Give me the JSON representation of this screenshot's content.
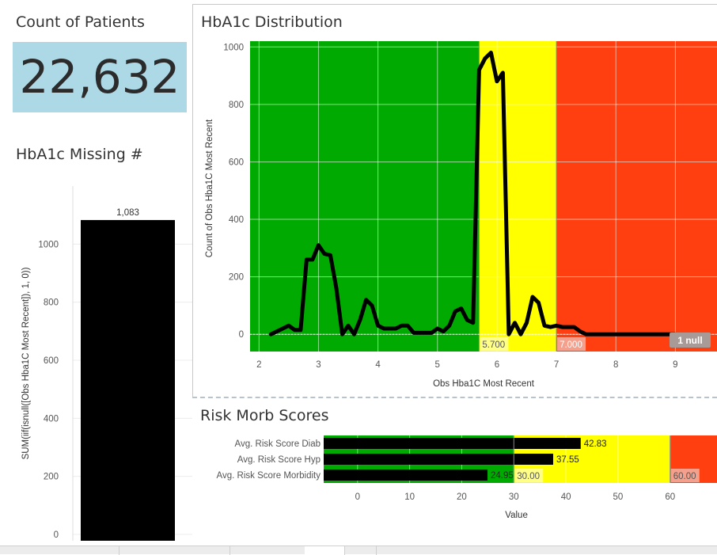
{
  "kpi": {
    "title": "Count of Patients",
    "value": "22,632",
    "bg_color": "#add8e6"
  },
  "missing": {
    "title": "HbA1c Missing #",
    "chart_data": {
      "type": "bar",
      "categories": [
        ""
      ],
      "values": [
        1083
      ],
      "data_label": "1,083",
      "ylabel": "SUM(iif(isnull([Obs Hba1C Most Recent]), 1, 0))",
      "ylim": [
        0,
        1200
      ],
      "yticks": [
        0,
        200,
        400,
        600,
        800,
        1000
      ],
      "bar_color": "#000000",
      "grid": true
    }
  },
  "distribution": {
    "title": "HbA1c Distribution",
    "chart_data": {
      "type": "line",
      "xlabel": "Obs Hba1C Most Recent",
      "ylabel": "Count of Obs Hba1C Most Recent",
      "xlim": [
        1.85,
        9.7
      ],
      "ylim": [
        -60,
        1020
      ],
      "xticks": [
        2,
        3,
        4,
        5,
        6,
        7,
        8,
        9
      ],
      "yticks": [
        0,
        200,
        400,
        600,
        800,
        1000
      ],
      "bands": [
        {
          "from": 1.85,
          "to": 5.7,
          "color": "#00aa00"
        },
        {
          "from": 5.7,
          "to": 7.0,
          "color": "#ffff00"
        },
        {
          "from": 7.0,
          "to": 9.7,
          "color": "#ff3f0f"
        }
      ],
      "reference_labels": [
        {
          "x": 5.7,
          "text": "5.700",
          "bg": "#ffff88",
          "fg": "#555555"
        },
        {
          "x": 7.0,
          "text": "7.000",
          "bg": "#f4a08c",
          "fg": "#ffffff"
        }
      ],
      "null_label": "1 null",
      "line_color": "#000000",
      "grid": true,
      "x": [
        2.2,
        2.3,
        2.4,
        2.5,
        2.6,
        2.7,
        2.8,
        2.9,
        3.0,
        3.1,
        3.2,
        3.3,
        3.4,
        3.5,
        3.6,
        3.7,
        3.8,
        3.9,
        4.0,
        4.1,
        4.2,
        4.3,
        4.4,
        4.5,
        4.6,
        4.7,
        4.8,
        4.9,
        5.0,
        5.1,
        5.2,
        5.3,
        5.4,
        5.5,
        5.6,
        5.7,
        5.8,
        5.9,
        6.0,
        6.1,
        6.2,
        6.3,
        6.4,
        6.5,
        6.6,
        6.7,
        6.8,
        6.9,
        7.0,
        7.1,
        7.2,
        7.3,
        7.4,
        7.5,
        7.6,
        7.7,
        7.8,
        7.9,
        8.0,
        8.2,
        8.4,
        8.6,
        8.8,
        9.0
      ],
      "y": [
        0,
        10,
        20,
        30,
        15,
        15,
        260,
        260,
        310,
        280,
        275,
        160,
        0,
        30,
        0,
        50,
        120,
        100,
        30,
        20,
        20,
        20,
        30,
        30,
        5,
        5,
        5,
        5,
        20,
        10,
        30,
        80,
        90,
        50,
        40,
        920,
        960,
        980,
        880,
        910,
        0,
        40,
        0,
        40,
        130,
        110,
        30,
        25,
        30,
        25,
        25,
        25,
        10,
        0,
        0,
        0,
        0,
        0,
        0,
        0,
        0,
        0,
        0,
        0
      ]
    }
  },
  "risk": {
    "title": "Risk Morb Scores",
    "chart_data": {
      "type": "bar",
      "orientation": "horizontal",
      "categories": [
        "Avg. Risk Score Diab",
        "Avg. Risk Score Hyp",
        "Avg. Risk Score Morbidity"
      ],
      "values": [
        42.83,
        37.55,
        24.95
      ],
      "value_labels": [
        "42.83",
        "37.55",
        "24.95"
      ],
      "xlabel": "Value",
      "xlim": [
        -6.5,
        69
      ],
      "xticks": [
        0,
        10,
        20,
        30,
        40,
        50,
        60
      ],
      "bands": [
        {
          "from": -6.5,
          "to": 30,
          "color": "#00aa00"
        },
        {
          "from": 30,
          "to": 60,
          "color": "#ffff00"
        },
        {
          "from": 60,
          "to": 69,
          "color": "#ff3f0f"
        }
      ],
      "reference_labels": [
        {
          "x": 30,
          "text": "30.00",
          "bg": "#ffff88",
          "fg": "#555555"
        },
        {
          "x": 60,
          "text": "60.00",
          "bg": "#f4a08c",
          "fg": "#555555"
        }
      ],
      "bar_color": "#000000",
      "grid": true
    }
  }
}
